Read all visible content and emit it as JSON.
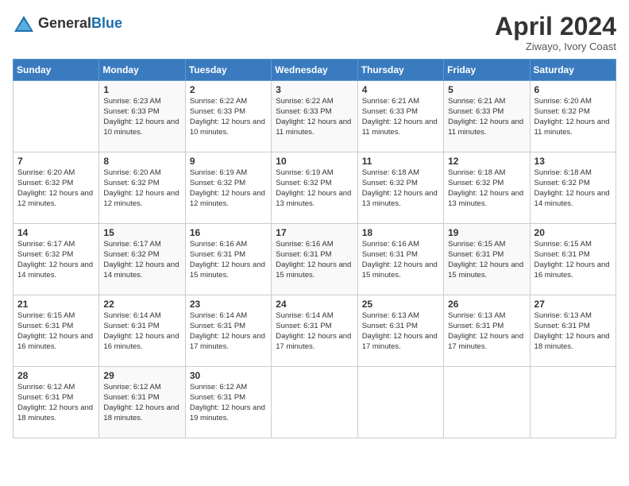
{
  "logo": {
    "general": "General",
    "blue": "Blue"
  },
  "title": "April 2024",
  "subtitle": "Ziwayo, Ivory Coast",
  "days_of_week": [
    "Sunday",
    "Monday",
    "Tuesday",
    "Wednesday",
    "Thursday",
    "Friday",
    "Saturday"
  ],
  "weeks": [
    [
      {
        "day": "",
        "sunrise": "",
        "sunset": "",
        "daylight": ""
      },
      {
        "day": "1",
        "sunrise": "Sunrise: 6:23 AM",
        "sunset": "Sunset: 6:33 PM",
        "daylight": "Daylight: 12 hours and 10 minutes."
      },
      {
        "day": "2",
        "sunrise": "Sunrise: 6:22 AM",
        "sunset": "Sunset: 6:33 PM",
        "daylight": "Daylight: 12 hours and 10 minutes."
      },
      {
        "day": "3",
        "sunrise": "Sunrise: 6:22 AM",
        "sunset": "Sunset: 6:33 PM",
        "daylight": "Daylight: 12 hours and 11 minutes."
      },
      {
        "day": "4",
        "sunrise": "Sunrise: 6:21 AM",
        "sunset": "Sunset: 6:33 PM",
        "daylight": "Daylight: 12 hours and 11 minutes."
      },
      {
        "day": "5",
        "sunrise": "Sunrise: 6:21 AM",
        "sunset": "Sunset: 6:33 PM",
        "daylight": "Daylight: 12 hours and 11 minutes."
      },
      {
        "day": "6",
        "sunrise": "Sunrise: 6:20 AM",
        "sunset": "Sunset: 6:32 PM",
        "daylight": "Daylight: 12 hours and 11 minutes."
      }
    ],
    [
      {
        "day": "7",
        "sunrise": "Sunrise: 6:20 AM",
        "sunset": "Sunset: 6:32 PM",
        "daylight": "Daylight: 12 hours and 12 minutes."
      },
      {
        "day": "8",
        "sunrise": "Sunrise: 6:20 AM",
        "sunset": "Sunset: 6:32 PM",
        "daylight": "Daylight: 12 hours and 12 minutes."
      },
      {
        "day": "9",
        "sunrise": "Sunrise: 6:19 AM",
        "sunset": "Sunset: 6:32 PM",
        "daylight": "Daylight: 12 hours and 12 minutes."
      },
      {
        "day": "10",
        "sunrise": "Sunrise: 6:19 AM",
        "sunset": "Sunset: 6:32 PM",
        "daylight": "Daylight: 12 hours and 13 minutes."
      },
      {
        "day": "11",
        "sunrise": "Sunrise: 6:18 AM",
        "sunset": "Sunset: 6:32 PM",
        "daylight": "Daylight: 12 hours and 13 minutes."
      },
      {
        "day": "12",
        "sunrise": "Sunrise: 6:18 AM",
        "sunset": "Sunset: 6:32 PM",
        "daylight": "Daylight: 12 hours and 13 minutes."
      },
      {
        "day": "13",
        "sunrise": "Sunrise: 6:18 AM",
        "sunset": "Sunset: 6:32 PM",
        "daylight": "Daylight: 12 hours and 14 minutes."
      }
    ],
    [
      {
        "day": "14",
        "sunrise": "Sunrise: 6:17 AM",
        "sunset": "Sunset: 6:32 PM",
        "daylight": "Daylight: 12 hours and 14 minutes."
      },
      {
        "day": "15",
        "sunrise": "Sunrise: 6:17 AM",
        "sunset": "Sunset: 6:32 PM",
        "daylight": "Daylight: 12 hours and 14 minutes."
      },
      {
        "day": "16",
        "sunrise": "Sunrise: 6:16 AM",
        "sunset": "Sunset: 6:31 PM",
        "daylight": "Daylight: 12 hours and 15 minutes."
      },
      {
        "day": "17",
        "sunrise": "Sunrise: 6:16 AM",
        "sunset": "Sunset: 6:31 PM",
        "daylight": "Daylight: 12 hours and 15 minutes."
      },
      {
        "day": "18",
        "sunrise": "Sunrise: 6:16 AM",
        "sunset": "Sunset: 6:31 PM",
        "daylight": "Daylight: 12 hours and 15 minutes."
      },
      {
        "day": "19",
        "sunrise": "Sunrise: 6:15 AM",
        "sunset": "Sunset: 6:31 PM",
        "daylight": "Daylight: 12 hours and 15 minutes."
      },
      {
        "day": "20",
        "sunrise": "Sunrise: 6:15 AM",
        "sunset": "Sunset: 6:31 PM",
        "daylight": "Daylight: 12 hours and 16 minutes."
      }
    ],
    [
      {
        "day": "21",
        "sunrise": "Sunrise: 6:15 AM",
        "sunset": "Sunset: 6:31 PM",
        "daylight": "Daylight: 12 hours and 16 minutes."
      },
      {
        "day": "22",
        "sunrise": "Sunrise: 6:14 AM",
        "sunset": "Sunset: 6:31 PM",
        "daylight": "Daylight: 12 hours and 16 minutes."
      },
      {
        "day": "23",
        "sunrise": "Sunrise: 6:14 AM",
        "sunset": "Sunset: 6:31 PM",
        "daylight": "Daylight: 12 hours and 17 minutes."
      },
      {
        "day": "24",
        "sunrise": "Sunrise: 6:14 AM",
        "sunset": "Sunset: 6:31 PM",
        "daylight": "Daylight: 12 hours and 17 minutes."
      },
      {
        "day": "25",
        "sunrise": "Sunrise: 6:13 AM",
        "sunset": "Sunset: 6:31 PM",
        "daylight": "Daylight: 12 hours and 17 minutes."
      },
      {
        "day": "26",
        "sunrise": "Sunrise: 6:13 AM",
        "sunset": "Sunset: 6:31 PM",
        "daylight": "Daylight: 12 hours and 17 minutes."
      },
      {
        "day": "27",
        "sunrise": "Sunrise: 6:13 AM",
        "sunset": "Sunset: 6:31 PM",
        "daylight": "Daylight: 12 hours and 18 minutes."
      }
    ],
    [
      {
        "day": "28",
        "sunrise": "Sunrise: 6:12 AM",
        "sunset": "Sunset: 6:31 PM",
        "daylight": "Daylight: 12 hours and 18 minutes."
      },
      {
        "day": "29",
        "sunrise": "Sunrise: 6:12 AM",
        "sunset": "Sunset: 6:31 PM",
        "daylight": "Daylight: 12 hours and 18 minutes."
      },
      {
        "day": "30",
        "sunrise": "Sunrise: 6:12 AM",
        "sunset": "Sunset: 6:31 PM",
        "daylight": "Daylight: 12 hours and 19 minutes."
      },
      {
        "day": "",
        "sunrise": "",
        "sunset": "",
        "daylight": ""
      },
      {
        "day": "",
        "sunrise": "",
        "sunset": "",
        "daylight": ""
      },
      {
        "day": "",
        "sunrise": "",
        "sunset": "",
        "daylight": ""
      },
      {
        "day": "",
        "sunrise": "",
        "sunset": "",
        "daylight": ""
      }
    ]
  ]
}
